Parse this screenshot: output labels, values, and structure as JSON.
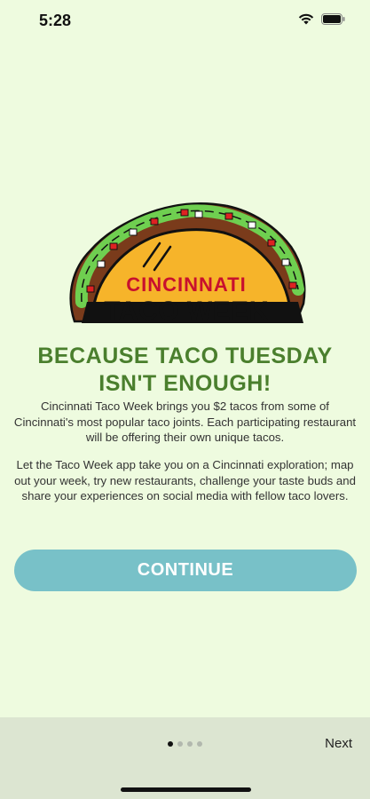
{
  "status_bar": {
    "time": "5:28",
    "icons": [
      "wifi-icon",
      "battery-icon"
    ]
  },
  "logo": {
    "line1": "CINCINNATI",
    "line2": "TACO WEEK"
  },
  "headline": {
    "line1": "BECAUSE TACO TUESDAY",
    "line2": "ISN'T ENOUGH!"
  },
  "body": {
    "paragraph1": "Cincinnati Taco Week brings you $2 tacos from some of Cincinnati's most popular taco joints. Each participating restaurant will be offering their own unique tacos.",
    "paragraph2": "Let the Taco Week app take you on a Cincinnati exploration; map out your week, try new restaurants, challenge your taste buds and share your experiences on social media with fellow taco lovers."
  },
  "actions": {
    "continue_label": "CONTINUE",
    "next_label": "Next"
  },
  "pagination": {
    "current_page": 1,
    "total_pages": 4
  },
  "colors": {
    "background": "#eefbdf",
    "headline": "#4a7f2d",
    "button": "#78c1c8",
    "logo_red": "#c8102e",
    "taco_shell": "#f6b42a"
  }
}
